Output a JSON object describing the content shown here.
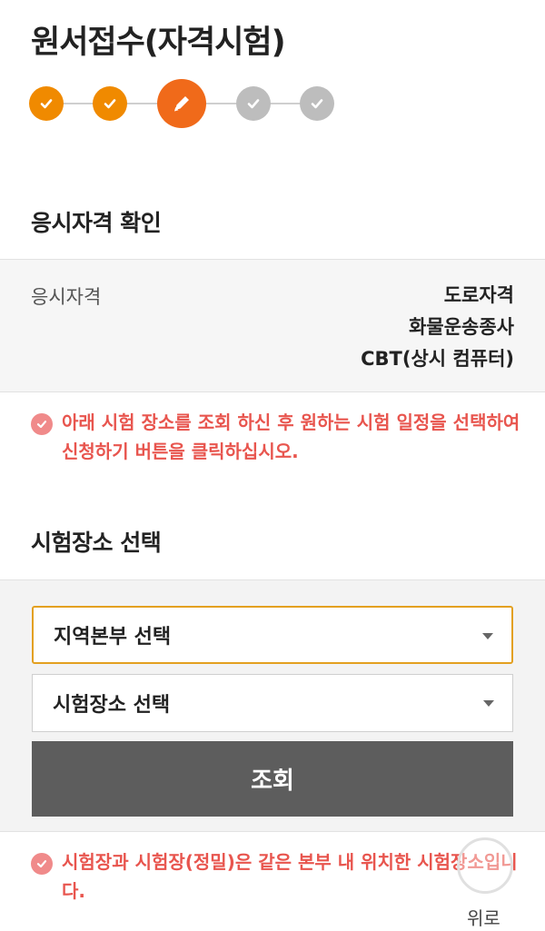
{
  "header": {
    "title": "원서접수(자격시험)"
  },
  "stepper": {
    "steps": [
      {
        "state": "done",
        "icon": "check-icon"
      },
      {
        "state": "done",
        "icon": "check-icon"
      },
      {
        "state": "current",
        "icon": "pencil-icon"
      },
      {
        "state": "todo",
        "icon": "check-icon"
      },
      {
        "state": "todo",
        "icon": "check-icon"
      }
    ],
    "colors": {
      "done": "#f08a00",
      "current": "#f06a1a",
      "todo": "#bdbdbd"
    }
  },
  "qualification": {
    "section_title": "응시자격 확인",
    "label": "응시자격",
    "values": [
      "도로자격",
      "화물운송종사",
      "CBT(상시 컴퓨터)"
    ]
  },
  "notice1": {
    "text": "아래 시험 장소를 조회 하신 후 원하는 시험 일정을 선택하여 신청하기 버튼을 클릭하십시오."
  },
  "venue": {
    "section_title": "시험장소 선택",
    "region_select": {
      "value": "지역본부 선택"
    },
    "venue_select": {
      "value": "시험장소 선택"
    },
    "search_label": "조회"
  },
  "notice2": {
    "text": "시험장과 시험장(정밀)은 같은 본부 내 위치한 시험장소입니다."
  },
  "scroll_top": {
    "label": "위로"
  },
  "colors": {
    "accent": "#f08a00",
    "notice": "#e8554e",
    "button": "#5d5d5d",
    "focus": "#e3a020"
  }
}
